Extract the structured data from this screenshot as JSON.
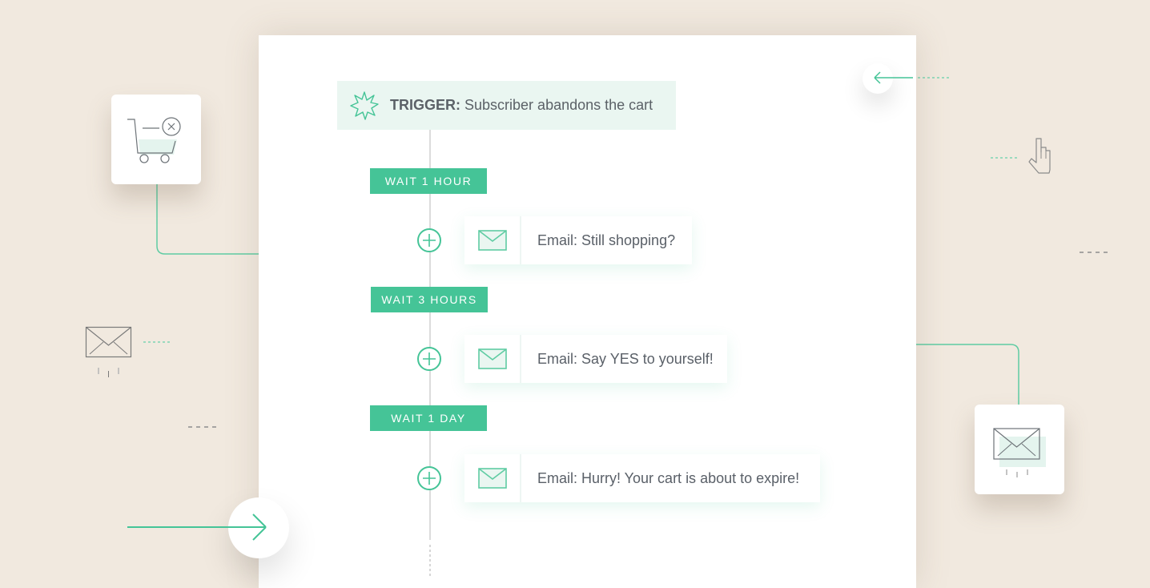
{
  "workflow": {
    "trigger": {
      "prefix": "TRIGGER:",
      "text": "Subscriber abandons the cart",
      "icon": "starburst-icon"
    },
    "steps": [
      {
        "wait": "WAIT 1 HOUR",
        "email": "Email: Still shopping?"
      },
      {
        "wait": "WAIT 3 HOURS",
        "email": "Email: Say YES to yourself!"
      },
      {
        "wait": "WAIT 1 DAY",
        "email": "Email: Hurry! Your cart is about to expire!"
      }
    ]
  },
  "decorations": {
    "cart_tile_icon": "cart-remove-icon",
    "envelope_tile_icon": "envelope-icon",
    "left_envelope_icon": "envelope-icon",
    "hand_icon": "pointer-hand-icon",
    "back_arrow_icon": "arrow-left-icon",
    "forward_arrow_icon": "arrow-right-icon"
  },
  "colors": {
    "accent": "#45c497",
    "background": "#f1e9df",
    "text": "#5a6068",
    "trigger_bg": "#eaf6f1"
  }
}
